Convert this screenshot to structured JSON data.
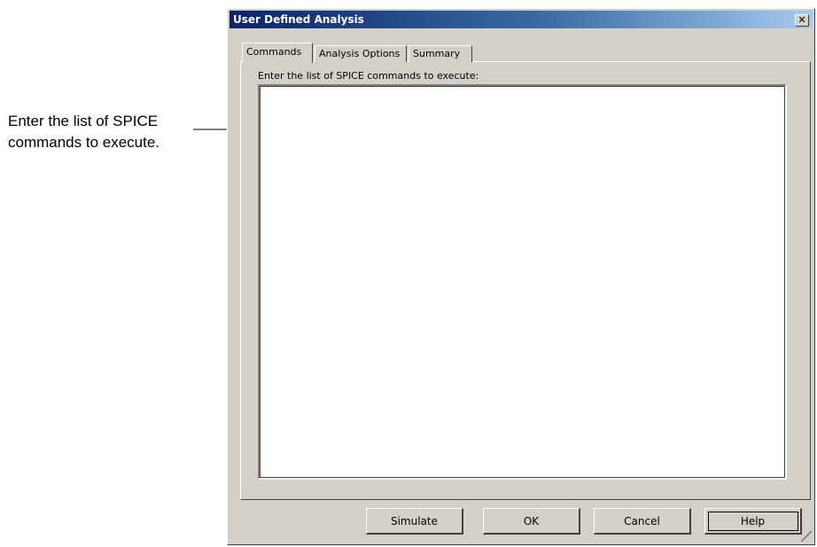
{
  "callout": {
    "line1": "Enter the list of SPICE",
    "line2": "commands to execute."
  },
  "dialog": {
    "title": "User Defined Analysis",
    "close_glyph": "✕",
    "tabs": [
      {
        "label": "Commands",
        "active": true
      },
      {
        "label": "Analysis Options",
        "active": false
      },
      {
        "label": "Summary",
        "active": false
      }
    ],
    "prompt": "Enter the list of SPICE commands to execute:",
    "commands_text": "",
    "buttons": {
      "simulate": "Simulate",
      "ok": "OK",
      "cancel": "Cancel",
      "help": "Help"
    },
    "colors": {
      "title_start": "#0a246a",
      "title_end": "#a6caf0",
      "face": "#d4d0c8"
    }
  }
}
